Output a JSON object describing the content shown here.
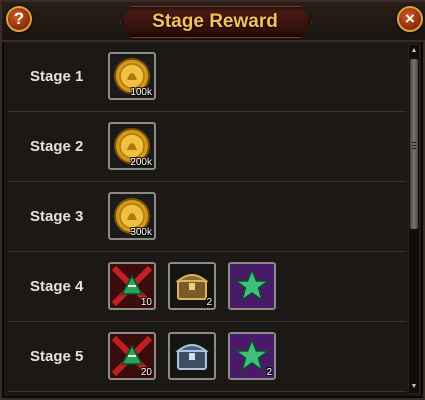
{
  "window": {
    "title": "Stage Reward",
    "help_label": "?",
    "close_label": "×"
  },
  "stages": [
    {
      "label": "Stage 1",
      "rewards": [
        {
          "type": "gold-coin",
          "qty": "100k"
        }
      ]
    },
    {
      "label": "Stage 2",
      "rewards": [
        {
          "type": "gold-coin",
          "qty": "200k"
        }
      ]
    },
    {
      "label": "Stage 3",
      "rewards": [
        {
          "type": "gold-coin",
          "qty": "300k"
        }
      ]
    },
    {
      "label": "Stage 4",
      "rewards": [
        {
          "type": "speedup-item",
          "qty": "10"
        },
        {
          "type": "gold-chest",
          "qty": "2"
        },
        {
          "type": "green-star",
          "qty": ""
        }
      ]
    },
    {
      "label": "Stage 5",
      "rewards": [
        {
          "type": "speedup-item",
          "qty": "20"
        },
        {
          "type": "silver-chest",
          "qty": ""
        },
        {
          "type": "green-star",
          "qty": "2"
        }
      ]
    }
  ],
  "colors": {
    "title": "#f2c15d",
    "accent_button": "#d35a22"
  }
}
